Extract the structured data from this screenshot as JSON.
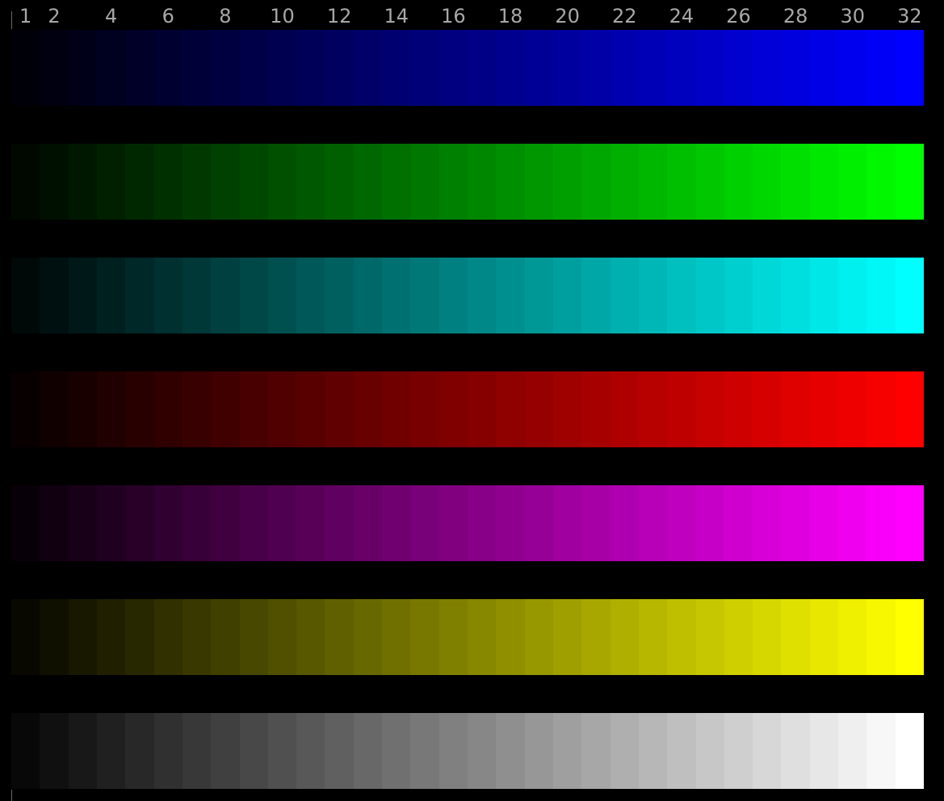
{
  "ruler": {
    "labels": [
      "1",
      "2",
      "4",
      "6",
      "8",
      "10",
      "12",
      "14",
      "16",
      "18",
      "20",
      "22",
      "24",
      "26",
      "28",
      "30",
      "32"
    ],
    "steps": [
      1,
      2,
      4,
      6,
      8,
      10,
      12,
      14,
      16,
      18,
      20,
      22,
      24,
      26,
      28,
      30,
      32
    ],
    "max_step": 32
  },
  "color_bars": [
    {
      "name": "blue",
      "color": "#0000ff"
    },
    {
      "name": "green",
      "color": "#00ff00"
    },
    {
      "name": "cyan",
      "color": "#00ffff"
    },
    {
      "name": "red",
      "color": "#ff0000"
    },
    {
      "name": "magenta",
      "color": "#ff00ff"
    },
    {
      "name": "yellow",
      "color": "#ffff00"
    },
    {
      "name": "gray",
      "color": "#ffffff"
    }
  ],
  "steps_per_bar": 32,
  "background_color": "#000000",
  "label_color": "#a8a8a8"
}
